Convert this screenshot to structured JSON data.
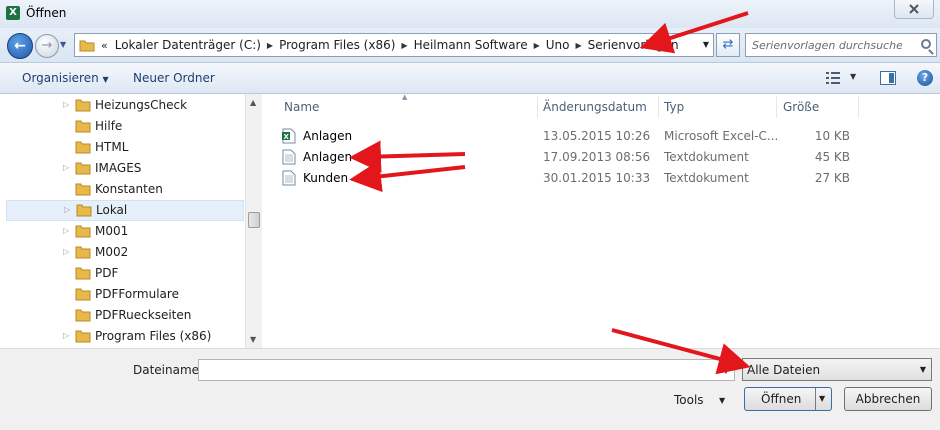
{
  "window": {
    "title": "Öffnen",
    "app_icon": "X"
  },
  "address": {
    "overflow": "«",
    "breadcrumbs": [
      "Lokaler Datenträger (C:)",
      "Program Files (x86)",
      "Heilmann Software",
      "Uno",
      "Serienvorlagen"
    ],
    "search_placeholder": "Serienvorlagen durchsuchen"
  },
  "toolbar": {
    "organize_label": "Organisieren",
    "new_folder_label": "Neuer Ordner",
    "help_label": "?"
  },
  "nav": {
    "items": [
      {
        "label": "HeizungsCheck",
        "expandable": true
      },
      {
        "label": "Hilfe",
        "expandable": false
      },
      {
        "label": "HTML",
        "expandable": false
      },
      {
        "label": "IMAGES",
        "expandable": true
      },
      {
        "label": "Konstanten",
        "expandable": false
      },
      {
        "label": "Lokal",
        "expandable": true,
        "selected": true
      },
      {
        "label": "M001",
        "expandable": true
      },
      {
        "label": "M002",
        "expandable": true
      },
      {
        "label": "PDF",
        "expandable": false
      },
      {
        "label": "PDFFormulare",
        "expandable": false
      },
      {
        "label": "PDFRueckseiten",
        "expandable": false
      },
      {
        "label": "Program Files (x86)",
        "expandable": true
      }
    ]
  },
  "files": {
    "columns": {
      "name": "Name",
      "date": "Änderungsdatum",
      "type": "Typ",
      "size": "Größe"
    },
    "rows": [
      {
        "icon": "excel-file-icon",
        "name": "Anlagen",
        "date": "13.05.2015 10:26",
        "type": "Microsoft Excel-C...",
        "size": "10 KB"
      },
      {
        "icon": "text-file-icon",
        "name": "Anlagen",
        "date": "17.09.2013 08:56",
        "type": "Textdokument",
        "size": "45 KB"
      },
      {
        "icon": "text-file-icon",
        "name": "Kunden",
        "date": "30.01.2015 10:33",
        "type": "Textdokument",
        "size": "27 KB"
      }
    ]
  },
  "footer": {
    "filename_label": "Dateiname:",
    "filename_value": "",
    "filter_value": "Alle Dateien",
    "tools_label": "Tools",
    "open_label": "Öffnen",
    "cancel_label": "Abbrechen"
  },
  "colors": {
    "annotation_arrow": "#e3161b",
    "folder": "#e8b84a",
    "selection": "#e5f0fb"
  }
}
